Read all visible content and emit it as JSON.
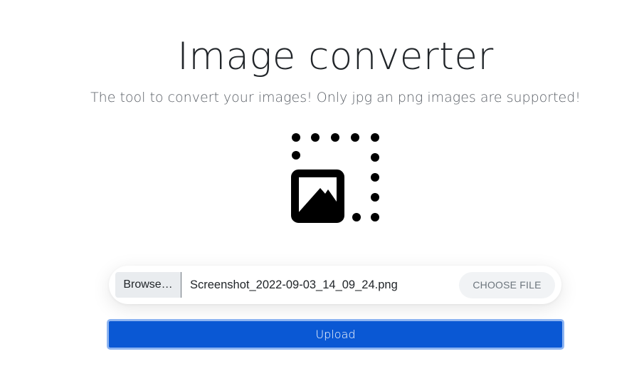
{
  "header": {
    "title": "Image converter",
    "subtitle": "The tool to convert your images! Only jpg an png images are supported!"
  },
  "hero": {
    "icon": "select-image-icon"
  },
  "file_input": {
    "browse_label": "Browse…",
    "file_name": "Screenshot_2022-09-03_14_09_24.png",
    "choose_label": "CHOOSE FILE"
  },
  "upload": {
    "label": "Upload"
  },
  "colors": {
    "accent": "#0a58d4",
    "accent_focus_ring": "#8db4f1",
    "text": "#212529",
    "muted": "#6c757d"
  }
}
